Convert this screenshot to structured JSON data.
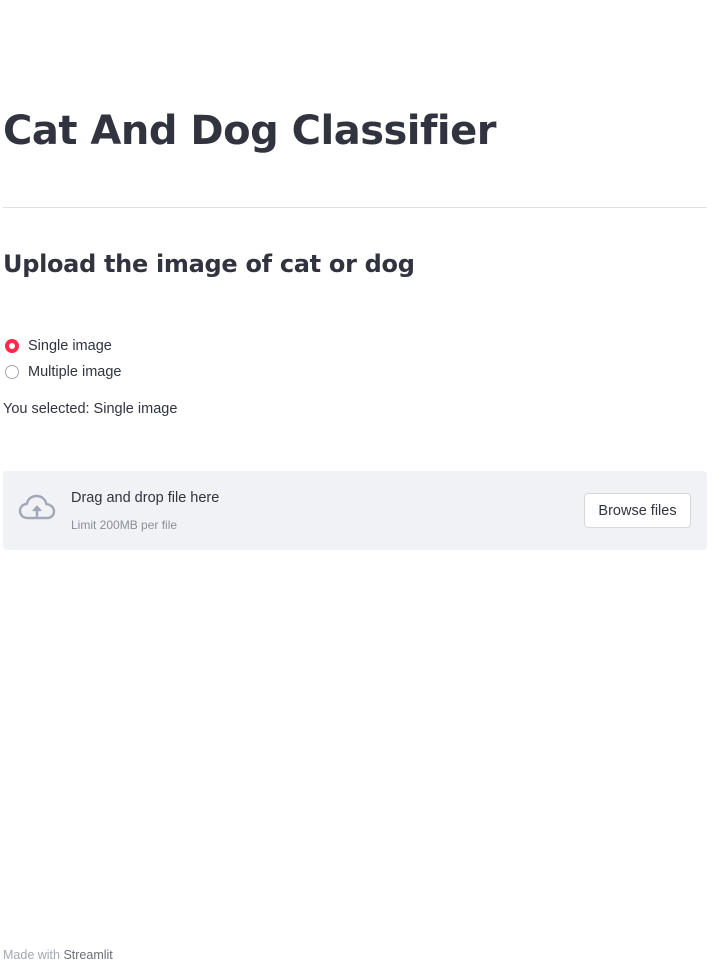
{
  "header": {
    "title": "Cat And Dog Classifier"
  },
  "main": {
    "subtitle": "Upload the image of cat or dog",
    "radio": {
      "options": [
        {
          "label": "Single image",
          "selected": true
        },
        {
          "label": "Multiple image",
          "selected": false
        }
      ]
    },
    "selected_text": "You selected: Single image",
    "uploader": {
      "drag_text": "Drag and drop file here",
      "limit_text": "Limit 200MB per file",
      "browse_label": "Browse files",
      "icon": "cloud-upload-icon"
    }
  },
  "footer": {
    "prefix": "Made with ",
    "brand": "Streamlit"
  },
  "colors": {
    "accent": "#ff2b4b",
    "text": "#31333f",
    "dropzone_bg": "#f0f2f6",
    "icon": "#a3a8b8"
  }
}
